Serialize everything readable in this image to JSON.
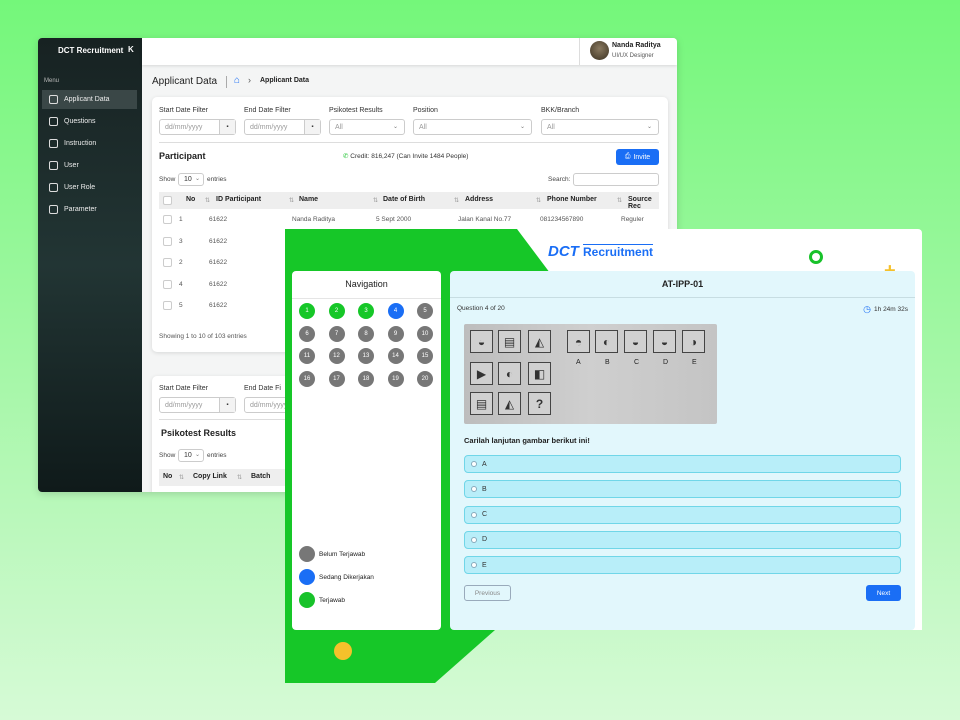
{
  "dashboard": {
    "logo": "DCT Recruitment",
    "collapse_icon": "K",
    "menu_label": "Menu",
    "sidebar": [
      {
        "label": "Applicant Data",
        "icon": "id-card-icon"
      },
      {
        "label": "Questions",
        "icon": "document-icon"
      },
      {
        "label": "Instruction",
        "icon": "info-book-icon"
      },
      {
        "label": "User",
        "icon": "user-icon"
      },
      {
        "label": "User Role",
        "icon": "user-role-icon"
      },
      {
        "label": "Parameter",
        "icon": "square-icon"
      }
    ],
    "user": {
      "name": "Nanda Raditya",
      "role": "UI/UX Designer"
    },
    "page_title": "Applicant Data",
    "breadcrumb_current": "Applicant Data",
    "filters": {
      "start_label": "Start Date Filter",
      "end_label": "End Date Filter",
      "psikotest_label": "Psikotest Results",
      "position_label": "Position",
      "branch_label": "BKK/Branch",
      "date_placeholder": "dd/mm/yyyy",
      "all": "All"
    },
    "participant": {
      "title": "Participant",
      "credit": "Credit: 816,247 (Can Invite 1484 People)",
      "invite": "Invite",
      "show": "Show",
      "entries_value": "10",
      "entries": "entries",
      "search": "Search:",
      "columns": [
        "No",
        "ID Participant",
        "Name",
        "Date of Birth",
        "Address",
        "Phone Number",
        "Source Rec"
      ],
      "rows": [
        {
          "no": "1",
          "id": "61622",
          "name": "Nanda Raditya",
          "dob": "5 Sept 2000",
          "address": "Jalan Kanal No.77",
          "phone": "081234567890",
          "source": "Reguler"
        },
        {
          "no": "3",
          "id": "61622"
        },
        {
          "no": "2",
          "id": "61622"
        },
        {
          "no": "4",
          "id": "61622"
        },
        {
          "no": "5",
          "id": "61622"
        }
      ],
      "showing": "Showing 1 to 10 of 103 entries"
    },
    "psikotest": {
      "start_label": "Start Date Filter",
      "end_label": "End Date Fi",
      "title": "Psikotest Results",
      "show": "Show",
      "entries_value": "10",
      "entries": "entries",
      "columns": [
        "No",
        "Copy Link",
        "Batch"
      ]
    }
  },
  "test": {
    "logo_dct": "DCT",
    "logo_rec": "Recruitment",
    "nav_title": "Navigation",
    "questions": [
      {
        "n": "1",
        "s": "answered"
      },
      {
        "n": "2",
        "s": "answered"
      },
      {
        "n": "3",
        "s": "answered"
      },
      {
        "n": "4",
        "s": "current"
      },
      {
        "n": "5",
        "s": "unanswered"
      },
      {
        "n": "6",
        "s": "unanswered"
      },
      {
        "n": "7",
        "s": "unanswered"
      },
      {
        "n": "8",
        "s": "unanswered"
      },
      {
        "n": "9",
        "s": "unanswered"
      },
      {
        "n": "10",
        "s": "unanswered"
      },
      {
        "n": "11",
        "s": "unanswered"
      },
      {
        "n": "12",
        "s": "unanswered"
      },
      {
        "n": "13",
        "s": "unanswered"
      },
      {
        "n": "14",
        "s": "unanswered"
      },
      {
        "n": "15",
        "s": "unanswered"
      },
      {
        "n": "16",
        "s": "unanswered"
      },
      {
        "n": "17",
        "s": "unanswered"
      },
      {
        "n": "18",
        "s": "unanswered"
      },
      {
        "n": "19",
        "s": "unanswered"
      },
      {
        "n": "20",
        "s": "unanswered"
      }
    ],
    "legend": [
      {
        "label": "Belum Terjawab",
        "color": "#777777"
      },
      {
        "label": "Sedang Dikerjakan",
        "color": "#1a6ef5"
      },
      {
        "label": "Terjawab",
        "color": "#18c22a"
      }
    ],
    "code": "AT-IPP-01",
    "progress": "Question 4 of 20",
    "timer": "1h 24m 32s",
    "figure_labels": [
      "A",
      "B",
      "C",
      "D",
      "E"
    ],
    "figure_question_mark": "?",
    "question": "Carilah lanjutan gambar berikut ini!",
    "options": [
      "A",
      "B",
      "C",
      "D",
      "E"
    ],
    "previous": "Previous",
    "next": "Next"
  },
  "colors": {
    "green": "#16c728",
    "blue": "#1a6ef5",
    "grey": "#777777",
    "panel": "#e2f7fc"
  }
}
